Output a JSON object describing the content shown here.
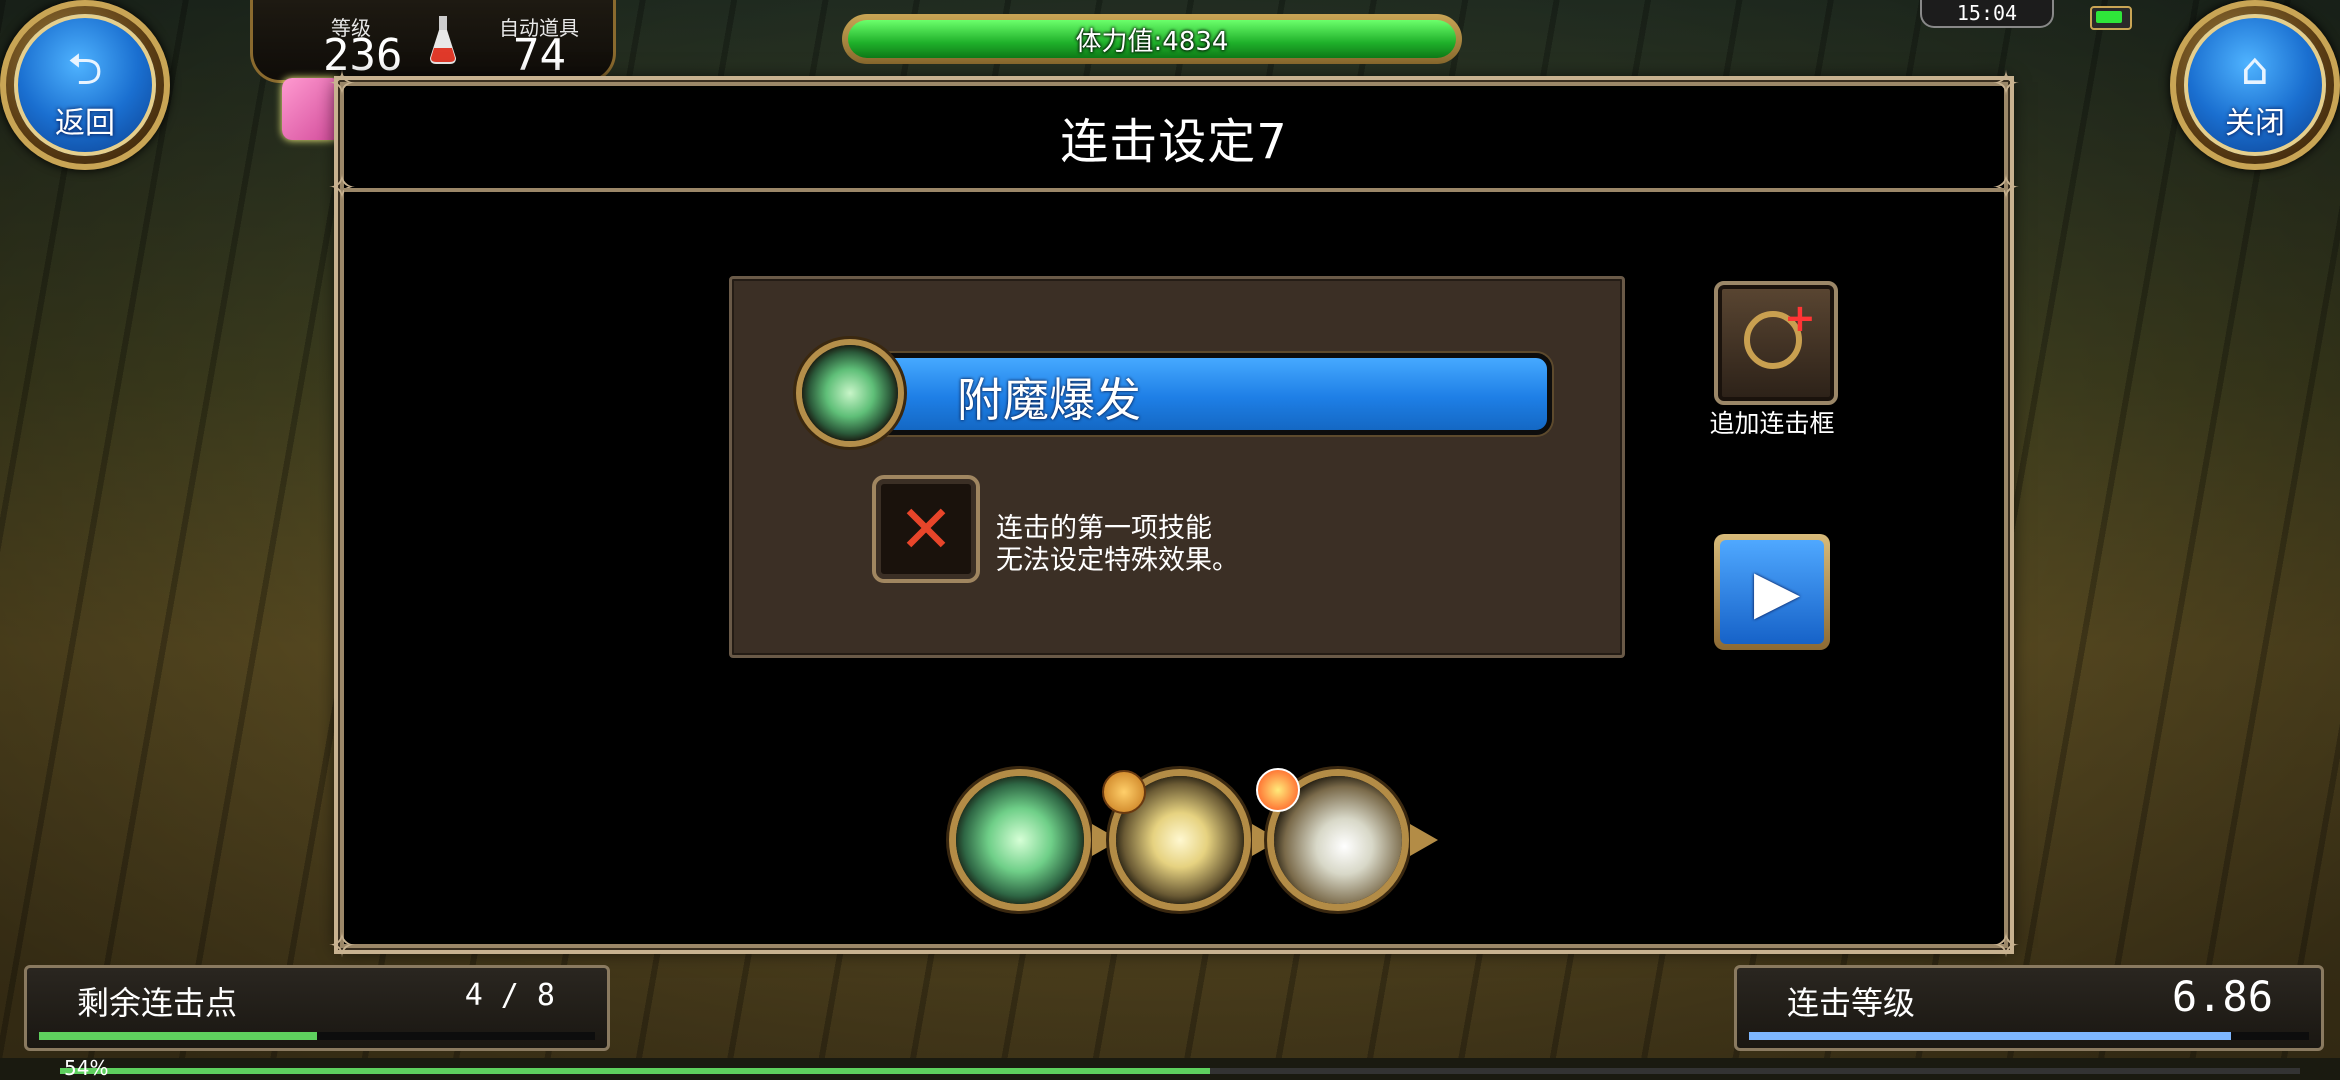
{
  "hud": {
    "back_label": "返回",
    "close_label": "关闭",
    "level_label": "等级",
    "level_value": "236",
    "auto_item_label": "自动道具",
    "auto_item_value": "74",
    "stamina": "体力值:4834",
    "clock": "15:04",
    "exp_percent": "54%"
  },
  "dialog": {
    "title": "连击设定7",
    "selected_skill": "附魔爆发",
    "x_message_line1": "连击的第一项技能",
    "x_message_line2": "无法设定特殊效果。",
    "add_combo_frame_label": "追加连击框"
  },
  "combo_icons": [
    "green-orb-skill-icon",
    "light-burst-skill-icon",
    "slash-skill-icon"
  ],
  "bottom": {
    "remaining_points_label": "剩余连击点",
    "remaining_points_value": "4 / 8",
    "remaining_points_fraction": 0.5,
    "combo_level_label": "连击等级",
    "combo_level_value": "6.86",
    "combo_level_fraction": 0.86
  },
  "colors": {
    "accent_blue": "#1e7fe6",
    "stamina_green": "#1fb02a",
    "gold_frame": "#c9a555"
  }
}
